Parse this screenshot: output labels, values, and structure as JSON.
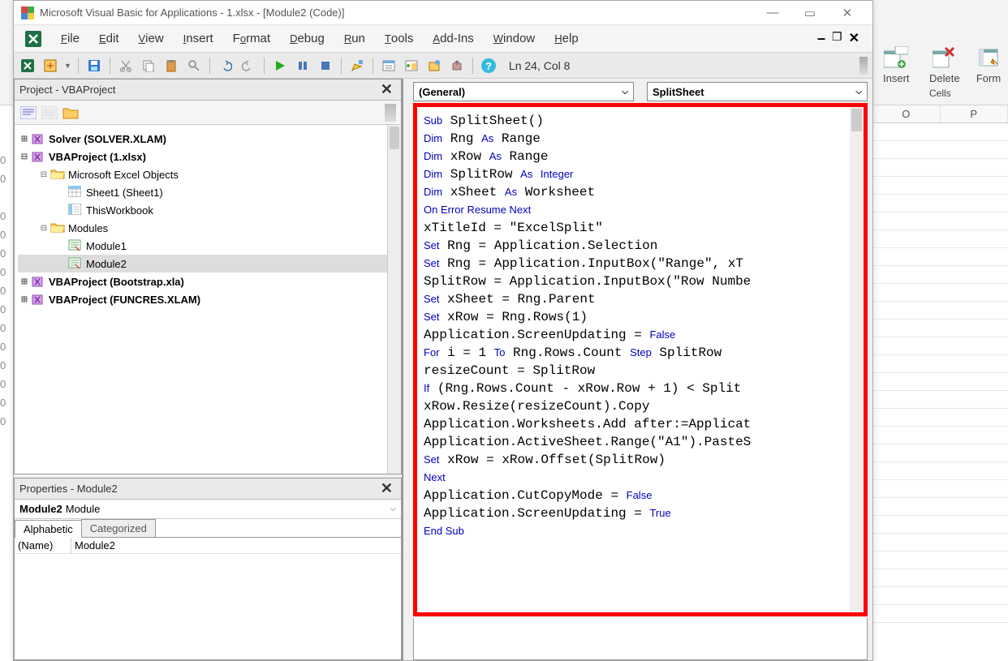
{
  "ribbon": {
    "insert": "Insert",
    "delete": "Delete",
    "format": "Form",
    "cells_group": "Cells"
  },
  "spreadsheet": {
    "row_hint": "0",
    "col_headers": [
      "O",
      "P"
    ]
  },
  "vba": {
    "title": "Microsoft Visual Basic for Applications - 1.xlsx - [Module2 (Code)]",
    "menu": {
      "file": "File",
      "edit": "Edit",
      "view": "View",
      "insert": "Insert",
      "format": "Format",
      "debug": "Debug",
      "run": "Run",
      "tools": "Tools",
      "addins": "Add-Ins",
      "window": "Window",
      "help": "Help"
    },
    "status": "Ln 24, Col 8",
    "project_panel_title": "Project - VBAProject",
    "projects": {
      "solver": "Solver (SOLVER.XLAM)",
      "vbaproj": "VBAProject (1.xlsx)",
      "excel_objects": "Microsoft Excel Objects",
      "sheet1": "Sheet1 (Sheet1)",
      "thisworkbook": "ThisWorkbook",
      "modules": "Modules",
      "module1": "Module1",
      "module2": "Module2",
      "bootstrap": "VBAProject (Bootstrap.xla)",
      "funcres": "VBAProject (FUNCRES.XLAM)"
    },
    "properties_panel_title": "Properties - Module2",
    "properties_object": "Module2",
    "properties_type": "Module",
    "properties_tabs": {
      "alphabetic": "Alphabetic",
      "categorized": "Categorized"
    },
    "properties_rows": [
      {
        "key": "(Name)",
        "value": "Module2"
      }
    ],
    "code_dropdowns": {
      "left": "(General)",
      "right": "SplitSheet"
    },
    "code": {
      "tokens": [
        [
          {
            "t": "Sub",
            "k": true
          },
          {
            "t": " SplitSheet()"
          }
        ],
        [
          {
            "t": "Dim",
            "k": true
          },
          {
            "t": " Rng "
          },
          {
            "t": "As",
            "k": true
          },
          {
            "t": " Range"
          }
        ],
        [
          {
            "t": "Dim",
            "k": true
          },
          {
            "t": " xRow "
          },
          {
            "t": "As",
            "k": true
          },
          {
            "t": " Range"
          }
        ],
        [
          {
            "t": "Dim",
            "k": true
          },
          {
            "t": " SplitRow "
          },
          {
            "t": "As",
            "k": true
          },
          {
            "t": " "
          },
          {
            "t": "Integer",
            "k": true
          }
        ],
        [
          {
            "t": "Dim",
            "k": true
          },
          {
            "t": " xSheet "
          },
          {
            "t": "As",
            "k": true
          },
          {
            "t": " Worksheet"
          }
        ],
        [
          {
            "t": "On Error Resume Next",
            "k": true
          }
        ],
        [
          {
            "t": "xTitleId = \"ExcelSplit\""
          }
        ],
        [
          {
            "t": "Set",
            "k": true
          },
          {
            "t": " Rng = Application.Selection"
          }
        ],
        [
          {
            "t": "Set",
            "k": true
          },
          {
            "t": " Rng = Application.InputBox(\"Range\", xT"
          }
        ],
        [
          {
            "t": "SplitRow = Application.InputBox(\"Row Numbe"
          }
        ],
        [
          {
            "t": "Set",
            "k": true
          },
          {
            "t": " xSheet = Rng.Parent"
          }
        ],
        [
          {
            "t": "Set",
            "k": true
          },
          {
            "t": " xRow = Rng.Rows(1)"
          }
        ],
        [
          {
            "t": "Application.ScreenUpdating = "
          },
          {
            "t": "False",
            "k": true
          }
        ],
        [
          {
            "t": "For",
            "k": true
          },
          {
            "t": " i = 1 "
          },
          {
            "t": "To",
            "k": true
          },
          {
            "t": " Rng.Rows.Count "
          },
          {
            "t": "Step",
            "k": true
          },
          {
            "t": " SplitRow"
          }
        ],
        [
          {
            "t": "resizeCount = SplitRow"
          }
        ],
        [
          {
            "t": "If",
            "k": true
          },
          {
            "t": " (Rng.Rows.Count - xRow.Row + 1) < Split"
          }
        ],
        [
          {
            "t": "xRow.Resize(resizeCount).Copy"
          }
        ],
        [
          {
            "t": "Application.Worksheets.Add after:=Applicat"
          }
        ],
        [
          {
            "t": "Application.ActiveSheet.Range(\"A1\").PasteS"
          }
        ],
        [
          {
            "t": "Set",
            "k": true
          },
          {
            "t": " xRow = xRow.Offset(SplitRow)"
          }
        ],
        [
          {
            "t": "Next",
            "k": true
          }
        ],
        [
          {
            "t": "Application.CutCopyMode = "
          },
          {
            "t": "False",
            "k": true
          }
        ],
        [
          {
            "t": "Application.ScreenUpdating = "
          },
          {
            "t": "True",
            "k": true
          }
        ],
        [
          {
            "t": "End Sub",
            "k": true
          }
        ]
      ]
    }
  }
}
